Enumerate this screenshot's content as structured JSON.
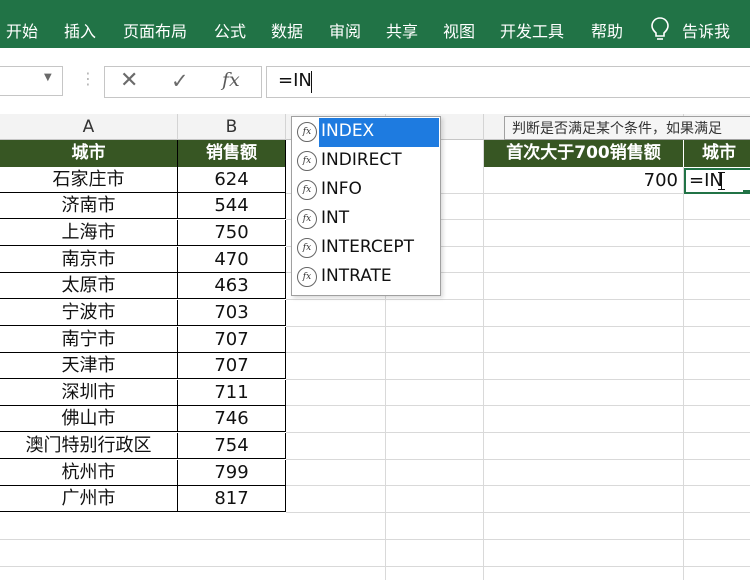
{
  "ribbon": {
    "tabs": [
      "开始",
      "插入",
      "页面布局",
      "公式",
      "数据",
      "审阅",
      "共享",
      "视图",
      "开发工具",
      "帮助"
    ],
    "tell_me": "告诉我"
  },
  "formula_bar": {
    "name_box": "",
    "formula": "=IN"
  },
  "columns": [
    "A",
    "B"
  ],
  "table": {
    "headers": [
      "城市",
      "销售额"
    ],
    "rows": [
      [
        "石家庄市",
        "624"
      ],
      [
        "济南市",
        "544"
      ],
      [
        "上海市",
        "750"
      ],
      [
        "南京市",
        "470"
      ],
      [
        "太原市",
        "463"
      ],
      [
        "宁波市",
        "703"
      ],
      [
        "南宁市",
        "707"
      ],
      [
        "天津市",
        "707"
      ],
      [
        "深圳市",
        "711"
      ],
      [
        "佛山市",
        "746"
      ],
      [
        "澳门特别行政区",
        "754"
      ],
      [
        "杭州市",
        "799"
      ],
      [
        "广州市",
        "817"
      ]
    ]
  },
  "autocomplete": {
    "items": [
      "INDEX",
      "INDIRECT",
      "INFO",
      "INT",
      "INTERCEPT",
      "INTRATE"
    ],
    "selected_index": 0
  },
  "tooltip": "判断是否满足某个条件，如果满足",
  "right_table": {
    "headers": [
      "首次大于700销售额",
      "城市"
    ],
    "value": "700",
    "editing": "=IN"
  },
  "colors": {
    "ribbon_green": "#217346",
    "header_green": "#375623",
    "selection_blue": "#1e7be0"
  }
}
